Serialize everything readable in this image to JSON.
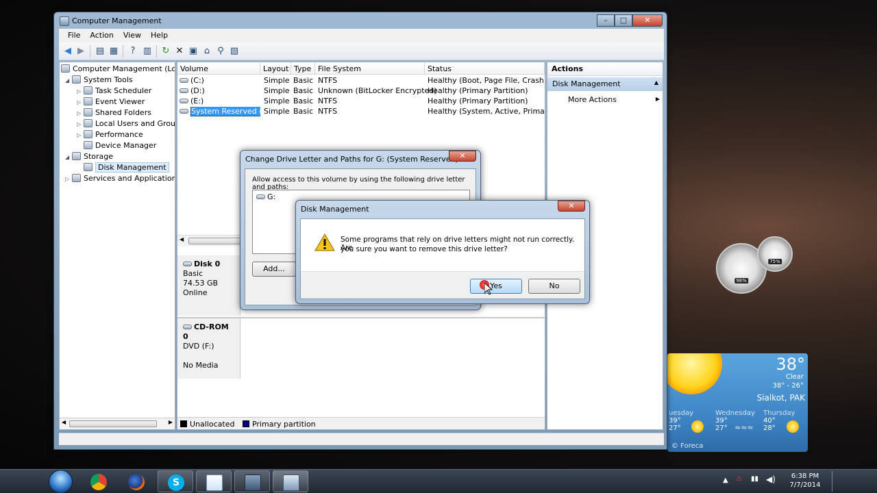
{
  "window": {
    "title": "Computer Management",
    "menu": [
      "File",
      "Action",
      "View",
      "Help"
    ]
  },
  "tree": {
    "root": "Computer Management (Local",
    "system_tools": "System Tools",
    "task_scheduler": "Task Scheduler",
    "event_viewer": "Event Viewer",
    "shared_folders": "Shared Folders",
    "local_users": "Local Users and Groups",
    "performance": "Performance",
    "device_manager": "Device Manager",
    "storage": "Storage",
    "disk_management": "Disk Management",
    "services": "Services and Applications"
  },
  "volumes": {
    "headers": {
      "volume": "Volume",
      "layout": "Layout",
      "type": "Type",
      "fs": "File System",
      "status": "Status"
    },
    "rows": [
      {
        "volume": "(C:)",
        "layout": "Simple",
        "type": "Basic",
        "fs": "NTFS",
        "status": "Healthy (Boot, Page File, Crash Dum"
      },
      {
        "volume": "(D:)",
        "layout": "Simple",
        "type": "Basic",
        "fs": "Unknown (BitLocker Encrypted)",
        "status": "Healthy (Primary Partition)"
      },
      {
        "volume": "(E:)",
        "layout": "Simple",
        "type": "Basic",
        "fs": "NTFS",
        "status": "Healthy (Primary Partition)"
      },
      {
        "volume": "System Reserved (G:)",
        "layout": "Simple",
        "type": "Basic",
        "fs": "NTFS",
        "status": "Healthy (System, Active, Primary Pa"
      }
    ]
  },
  "disks": {
    "disk0": {
      "name": "Disk 0",
      "type": "Basic",
      "size": "74.53 GB",
      "state": "Online"
    },
    "cdrom0": {
      "name": "CD-ROM 0",
      "type": "DVD (F:)",
      "media": "No Media"
    }
  },
  "legend": {
    "unallocated": "Unallocated",
    "primary": "Primary partition"
  },
  "actions": {
    "header": "Actions",
    "section": "Disk Management",
    "more": "More Actions"
  },
  "change_dialog": {
    "title": "Change Drive Letter and Paths for G: (System Reserved)",
    "instruction": "Allow access to this volume by using the following drive letter and paths:",
    "entry": "G:",
    "add": "Add..."
  },
  "confirm_dialog": {
    "title": "Disk Management",
    "message_line1": "Some programs that rely on drive letters might not run correctly. Are",
    "message_line2": "you sure you want to remove this drive letter?",
    "yes": "Yes",
    "no": "No"
  },
  "weather": {
    "temp": "38°",
    "condition": "Clear",
    "range": "38° - 26°",
    "city": "Sialkot, PAK",
    "days": [
      {
        "day": "uesday",
        "hi": "39°",
        "lo": "27°"
      },
      {
        "day": "Wednesday",
        "hi": "39°",
        "lo": "27°"
      },
      {
        "day": "Thursday",
        "hi": "40°",
        "lo": "28°"
      }
    ],
    "brand": "© Foreca"
  },
  "gauges": {
    "cpu": "98%",
    "ram": "75%"
  },
  "clock": {
    "time": "6:38 PM",
    "date": "7/7/2014"
  },
  "colors": {
    "accent": "#3399ff",
    "primary_partition": "#000080",
    "unallocated": "#000000"
  }
}
